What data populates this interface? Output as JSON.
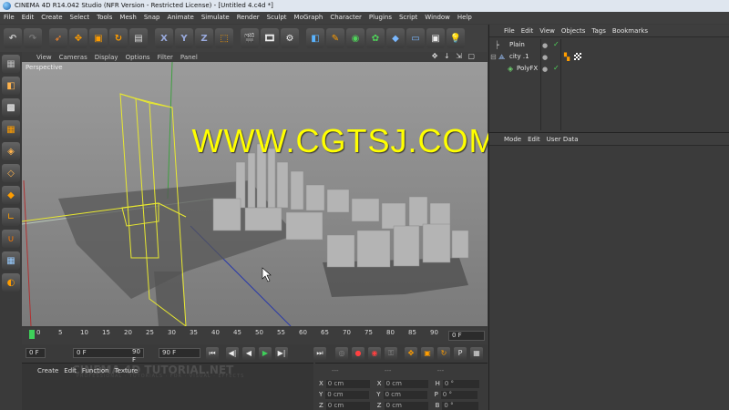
{
  "window": {
    "title": "CINEMA 4D R14.042 Studio (NFR Version - Restricted License) - [Untitled 4.c4d *]"
  },
  "menubar": [
    "File",
    "Edit",
    "Create",
    "Select",
    "Tools",
    "Mesh",
    "Snap",
    "Animate",
    "Simulate",
    "Render",
    "Sculpt",
    "MoGraph",
    "Character",
    "Plugins",
    "Script",
    "Window",
    "Help"
  ],
  "toolbar": {
    "axis_labels": {
      "x": "X",
      "y": "Y",
      "z": "Z"
    },
    "icons": [
      "undo-icon",
      "redo-icon",
      "live-select-icon",
      "move-icon",
      "scale-icon",
      "rotate-icon",
      "recent-tools-icon",
      "x-axis-lock-icon",
      "y-axis-lock-icon",
      "z-axis-lock-icon",
      "coordinate-system-icon",
      "render-view-icon",
      "render-picture-viewer-icon",
      "render-settings-icon",
      "cube-icon",
      "spline-pen-icon",
      "nurbs-icon",
      "array-icon",
      "deformer-icon",
      "floor-icon",
      "camera-icon",
      "light-icon"
    ]
  },
  "left_tools": [
    "make-editable-icon",
    "model-mode-icon",
    "texture-mode-icon",
    "workplane-icon",
    "points-mode-icon",
    "edges-mode-icon",
    "polygons-mode-icon",
    "axis-mode-icon",
    "magnet-icon",
    "snap-icon",
    "locked-workplane-icon"
  ],
  "viewport": {
    "menu": [
      "View",
      "Cameras",
      "Display",
      "Options",
      "Filter",
      "Panel"
    ],
    "label": "Perspective",
    "nav_icons": "✥ ↓ ⇲ ▢"
  },
  "watermark": "WWW.CGTSJ.COM",
  "timeline": {
    "ticks": [
      "0",
      "5",
      "10",
      "15",
      "20",
      "25",
      "30",
      "35",
      "40",
      "45",
      "50",
      "55",
      "60",
      "65",
      "70",
      "75",
      "80",
      "85",
      "90"
    ],
    "current_frame": "0 F"
  },
  "transport": {
    "start_field": "0 F",
    "min_field": "0 F",
    "max_field": "90 F",
    "end_field": "90 F",
    "buttons": [
      "⏮",
      "◀|",
      "◀",
      "▶",
      "▶|",
      "⏭"
    ]
  },
  "material_manager": {
    "menu": [
      "Create",
      "Edit",
      "Function",
      "Texture"
    ],
    "watermark_title": "CINEMA 4D TUTORIAL.NET",
    "watermark_subtitle": "PROFESSIONAL · TUTORIALS · FOR · VISUAL · EFFECTS"
  },
  "coordinates": {
    "headers": [
      "---",
      "---",
      "---"
    ],
    "rows": [
      {
        "axis": "X",
        "pos": "0 cm",
        "size_axis": "X",
        "size": "0 cm",
        "rot_axis": "H",
        "rot": "0 °"
      },
      {
        "axis": "Y",
        "pos": "0 cm",
        "size_axis": "Y",
        "size": "0 cm",
        "rot_axis": "P",
        "rot": "0 °"
      },
      {
        "axis": "Z",
        "pos": "0 cm",
        "size_axis": "Z",
        "size": "0 cm",
        "rot_axis": "B",
        "rot": "0 °"
      }
    ]
  },
  "object_manager": {
    "menu": [
      "File",
      "Edit",
      "View",
      "Objects",
      "Tags",
      "Bookmarks"
    ],
    "objects": [
      {
        "name": "Plain",
        "icon": "plain-deformer-icon",
        "check": "✓"
      },
      {
        "name": "city .1",
        "icon": "null-object-icon",
        "check": ""
      },
      {
        "name": "PolyFX",
        "icon": "polyfx-icon",
        "check": "✓"
      }
    ]
  },
  "attribute_manager": {
    "menu": [
      "Mode",
      "Edit",
      "User Data"
    ]
  },
  "colors": {
    "accent_yellow": "#ffff00",
    "play_green": "#3ed05a",
    "viewport_bg": "#8c8c8c"
  }
}
